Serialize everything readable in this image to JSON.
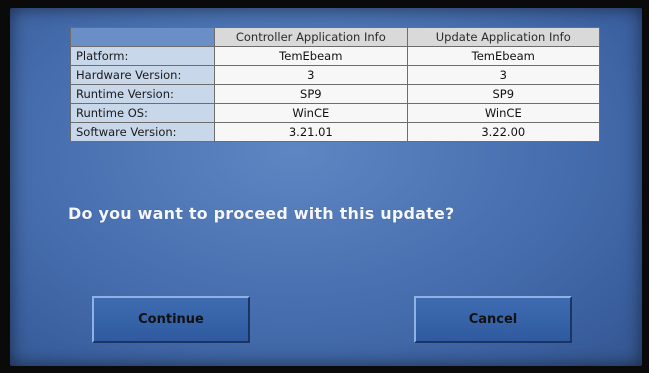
{
  "table": {
    "headers": [
      "",
      "Controller Application Info",
      "Update Application Info"
    ],
    "rows": [
      {
        "label": "Platform:",
        "controller": "TemEbeam",
        "update": "TemEbeam"
      },
      {
        "label": "Hardware Version:",
        "controller": "3",
        "update": "3"
      },
      {
        "label": "Runtime Version:",
        "controller": "SP9",
        "update": "SP9"
      },
      {
        "label": "Runtime OS:",
        "controller": "WinCE",
        "update": "WinCE"
      },
      {
        "label": "Software Version:",
        "controller": "3.21.01",
        "update": "3.22.00"
      }
    ]
  },
  "prompt": {
    "question": "Do you want to proceed with this update?"
  },
  "buttons": {
    "continue_label": "Continue",
    "cancel_label": "Cancel"
  },
  "colors": {
    "screen_background": "#4a72b2",
    "button_face": "#3a66ad",
    "header_cell": "#d9d9d9",
    "label_cell": "#c8d8ea"
  }
}
